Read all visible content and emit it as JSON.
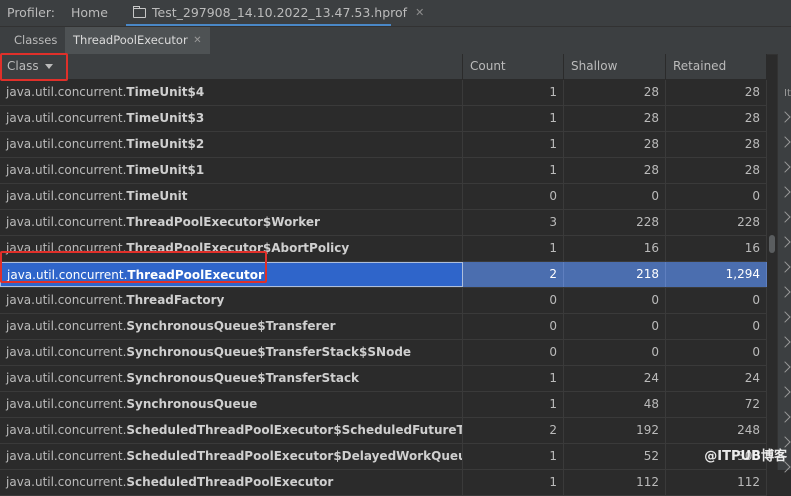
{
  "topbar": {
    "profiler_label": "Profiler:",
    "home_tab": "Home",
    "file_tab": "Test_297908_14.10.2022_13.47.53.hprof"
  },
  "subtabs": {
    "classes": "Classes",
    "thread_pool_executor": "ThreadPoolExecutor"
  },
  "table": {
    "columns": {
      "class": "Class",
      "count": "Count",
      "shallow": "Shallow",
      "retained": "Retained"
    },
    "rows": [
      {
        "pkg": "java.util.concurrent.",
        "cls": "TimeUnit$4",
        "count": "1",
        "shallow": "28",
        "retained": "28"
      },
      {
        "pkg": "java.util.concurrent.",
        "cls": "TimeUnit$3",
        "count": "1",
        "shallow": "28",
        "retained": "28"
      },
      {
        "pkg": "java.util.concurrent.",
        "cls": "TimeUnit$2",
        "count": "1",
        "shallow": "28",
        "retained": "28"
      },
      {
        "pkg": "java.util.concurrent.",
        "cls": "TimeUnit$1",
        "count": "1",
        "shallow": "28",
        "retained": "28"
      },
      {
        "pkg": "java.util.concurrent.",
        "cls": "TimeUnit",
        "count": "0",
        "shallow": "0",
        "retained": "0"
      },
      {
        "pkg": "java.util.concurrent.",
        "cls": "ThreadPoolExecutor$Worker",
        "count": "3",
        "shallow": "228",
        "retained": "228"
      },
      {
        "pkg": "java.util.concurrent.",
        "cls": "ThreadPoolExecutor$AbortPolicy",
        "count": "1",
        "shallow": "16",
        "retained": "16"
      },
      {
        "pkg": "java.util.concurrent.",
        "cls": "ThreadPoolExecutor",
        "count": "2",
        "shallow": "218",
        "retained": "1,294"
      },
      {
        "pkg": "java.util.concurrent.",
        "cls": "ThreadFactory",
        "count": "0",
        "shallow": "0",
        "retained": "0"
      },
      {
        "pkg": "java.util.concurrent.",
        "cls": "SynchronousQueue$Transferer",
        "count": "0",
        "shallow": "0",
        "retained": "0"
      },
      {
        "pkg": "java.util.concurrent.",
        "cls": "SynchronousQueue$TransferStack$SNode",
        "count": "0",
        "shallow": "0",
        "retained": "0"
      },
      {
        "pkg": "java.util.concurrent.",
        "cls": "SynchronousQueue$TransferStack",
        "count": "1",
        "shallow": "24",
        "retained": "24"
      },
      {
        "pkg": "java.util.concurrent.",
        "cls": "SynchronousQueue",
        "count": "1",
        "shallow": "48",
        "retained": "72"
      },
      {
        "pkg": "java.util.concurrent.",
        "cls": "ScheduledThreadPoolExecutor$ScheduledFutureTask",
        "count": "2",
        "shallow": "192",
        "retained": "248"
      },
      {
        "pkg": "java.util.concurrent.",
        "cls": "ScheduledThreadPoolExecutor$DelayedWorkQueue",
        "count": "1",
        "shallow": "52",
        "retained": "300"
      },
      {
        "pkg": "java.util.concurrent.",
        "cls": "ScheduledThreadPoolExecutor",
        "count": "1",
        "shallow": "112",
        "retained": "112"
      }
    ]
  },
  "right_panel": {
    "label": "It"
  },
  "watermark": "@ITPUB博客",
  "colors": {
    "selection": "#2f65ca",
    "highlight_box": "#e0302a",
    "tab_underline": "#4a88c7"
  }
}
